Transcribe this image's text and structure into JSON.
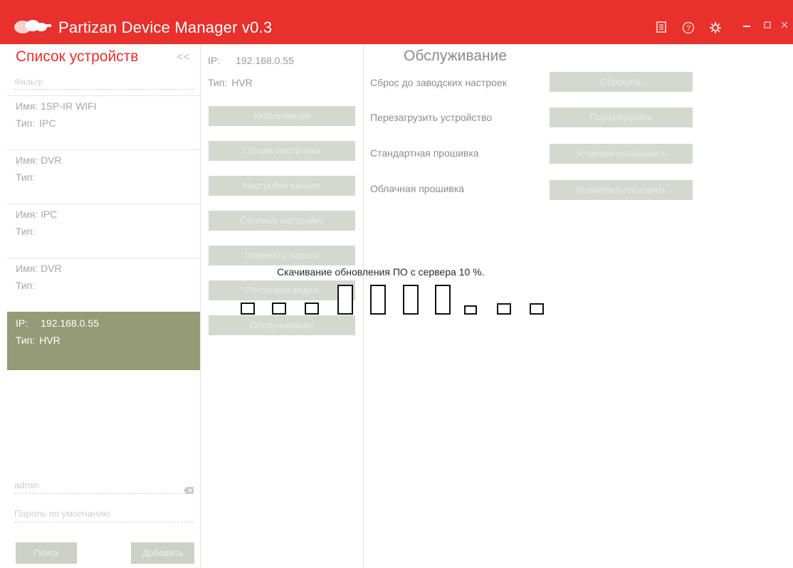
{
  "titlebar": {
    "title": "Partizan Device Manager v0.3",
    "icons": [
      "logo-icon",
      "list-icon",
      "help-icon",
      "settings-icon",
      "minimize-icon",
      "maximize-icon",
      "close-icon"
    ],
    "color": "#e8302c"
  },
  "sidebar": {
    "title": "Список устройств",
    "collapse_label": "<<",
    "filter_placeholder": "Фильтр",
    "devices": [
      {
        "name_label": "Имя:",
        "name": "1SP-IR WIFI",
        "type_label": "Тип:",
        "type": "IPC"
      },
      {
        "name_label": "Имя:",
        "name": "DVR",
        "type_label": "Тип:",
        "type": ""
      },
      {
        "name_label": "Имя:",
        "name": "IPC",
        "type_label": "Тип:",
        "type": ""
      },
      {
        "name_label": "Имя:",
        "name": "DVR",
        "type_label": "Тип:",
        "type": ""
      },
      {
        "name_label": "IP:",
        "name": "192.168.0.55",
        "type_label": "Тип:",
        "type": "HVR"
      }
    ],
    "selected_color": "#969b77",
    "login_value": "admin",
    "password_placeholder": "Пароль по умолчанию",
    "search_button": "Поиск",
    "add_button": "Добавить"
  },
  "device": {
    "ip_label": "IP:",
    "ip": "192.168.0.55",
    "type_label": "Тип:",
    "type": "HVR",
    "menu": [
      "Информация",
      "Общие настройки",
      "Настройки канала",
      "Сетевые настройки",
      "Поменять пароль",
      "Потоковое видео",
      "Обслуживание"
    ]
  },
  "service": {
    "title": "Обслуживание",
    "rows": [
      {
        "label": "Сброс до заводских настроек",
        "button": "Сбросить"
      },
      {
        "label": "Перезагрузить устройство",
        "button": "Перезагрузить"
      },
      {
        "label": "Стандартная прошивка",
        "button": "Установить/обновить"
      },
      {
        "label": "Облачная прошивка",
        "button": "Установить/обновить"
      }
    ]
  },
  "status": {
    "message": "Скачивание обновления ПО с сервера 10 %."
  }
}
